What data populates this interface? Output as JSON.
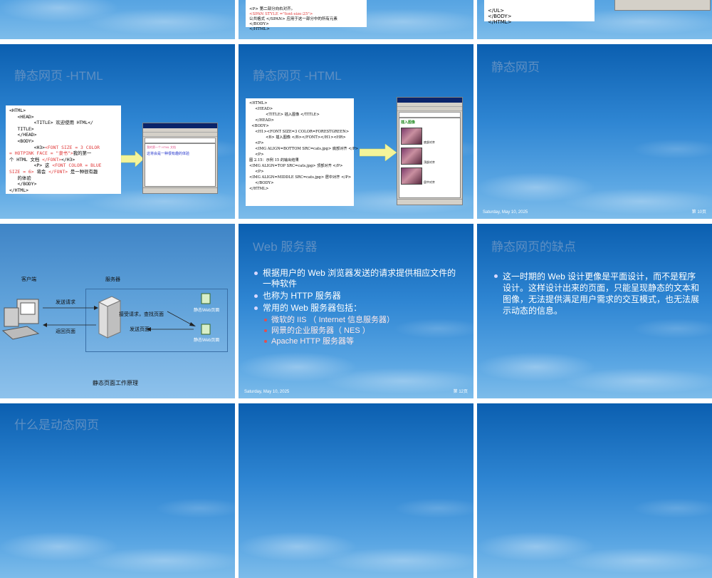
{
  "top_row": {
    "s2_lines": [
      "<P> 第二部分向右对齐。",
      "<SPAN STYLE =\"font-size:25\">",
      "公共格式 </SPAN> 应用于这一部分中的所有元素",
      "</BODY>",
      "</HTML>"
    ],
    "s3_lines": [
      "</UL>",
      "</BODY>",
      "</HTML>"
    ]
  },
  "slide4": {
    "title": "静态网页 -HTML",
    "code": [
      {
        "t": "<HTML>"
      },
      {
        "t": "   <HEAD>"
      },
      {
        "t": "         <TITLE> 欢迎使用 HTML</"
      },
      {
        "t": "   TITLE>"
      },
      {
        "t": "   </HEAD>"
      },
      {
        "t": "   <BODY>"
      },
      {
        "t": "         <H3>",
        "r": "<FONT SIZE = 3 COLOR"
      },
      {
        "r": "= HOTPINK FACE = \"隶书\">",
        "t": "我的第一"
      },
      {
        "t": "个 HTML 文档 ",
        "r": "</FONT>",
        "t2": "</H3>"
      },
      {
        "t": "         <P> 这 ",
        "r": "<FONT COLOR = BLUE"
      },
      {
        "r": "SIZE = 6>",
        "t": " 将会 ",
        "r2": "</FONT>",
        "t2": " 是一种很有趣"
      },
      {
        "t": "   的体验"
      },
      {
        "t": "   </BODY>"
      },
      {
        "t": "</HTML>"
      }
    ],
    "browser_text": "这将会是一种很有趣的体验",
    "browser_heading": "我的第一个 HTML 文档"
  },
  "slide5": {
    "title": "静态网页 -HTML",
    "code": [
      "<HTML>",
      "     <HEAD>",
      "              <TITLE> 插入图像 </TITLE>",
      "",
      "     </HEAD>",
      "  <BODY>",
      "     <H1><FONT SIZE=3 COLOR=FORESTGREEN>",
      "              <B> 插入图像 </B></FONT></H1><HR>",
      "     <P>",
      "     <IMG ALIGN=BOTTOM SRC=cats.jpg> 底部对齐 </P>",
      "     <P>",
      "图 2.15：示例 15 的输出结果",
      "<IMG ALIGN=TOP SRC=cats.jpg> 顶部对齐 </P>",
      "     <P>",
      "<IMG ALIGN=MIDDLE SRC=cats.jpg> 居中对齐 </P>",
      "     </BODY>",
      "</HTML>"
    ],
    "browser_heading": "插入图像",
    "captions": [
      "底部对齐",
      "顶部对齐",
      "居中对齐"
    ]
  },
  "slide6": {
    "title": "静态网页",
    "date": "Saturday, May 10, 2025",
    "page": "第 10页"
  },
  "slide7": {
    "client_label": "客户端",
    "server_label": "服务器",
    "send_request": "发送请求",
    "return_page": "返回页面",
    "receive_request": "接受请求，查找页面",
    "send_page": "发送页面",
    "static_page_1": "静态Web页面",
    "static_page_2": "静态Web页面",
    "caption": "静态页面工作原理"
  },
  "slide8": {
    "title": "Web 服务器",
    "bullets": [
      "根据用户的 Web 浏览器发送的请求提供相应文件的一种软件",
      "也称为 HTTP 服务器",
      "常用的 Web 服务器包括："
    ],
    "sub_bullets": [
      "微软的 IIS （ Internet 信息服务器）",
      "网景的企业服务器（ NES ）",
      "Apache HTTP 服务器等"
    ],
    "date": "Saturday, May 10, 2025",
    "page": "第 12页"
  },
  "slide9": {
    "title": "静态网页的缺点",
    "bullet": "这一时期的 Web 设计更像是平面设计，而不是程序设计。这样设计出来的页面，只能呈现静态的文本和图像，无法提供满足用户需求的交互模式，也无法展示动态的信息。"
  },
  "slide10": {
    "title": "什么是动态网页"
  }
}
